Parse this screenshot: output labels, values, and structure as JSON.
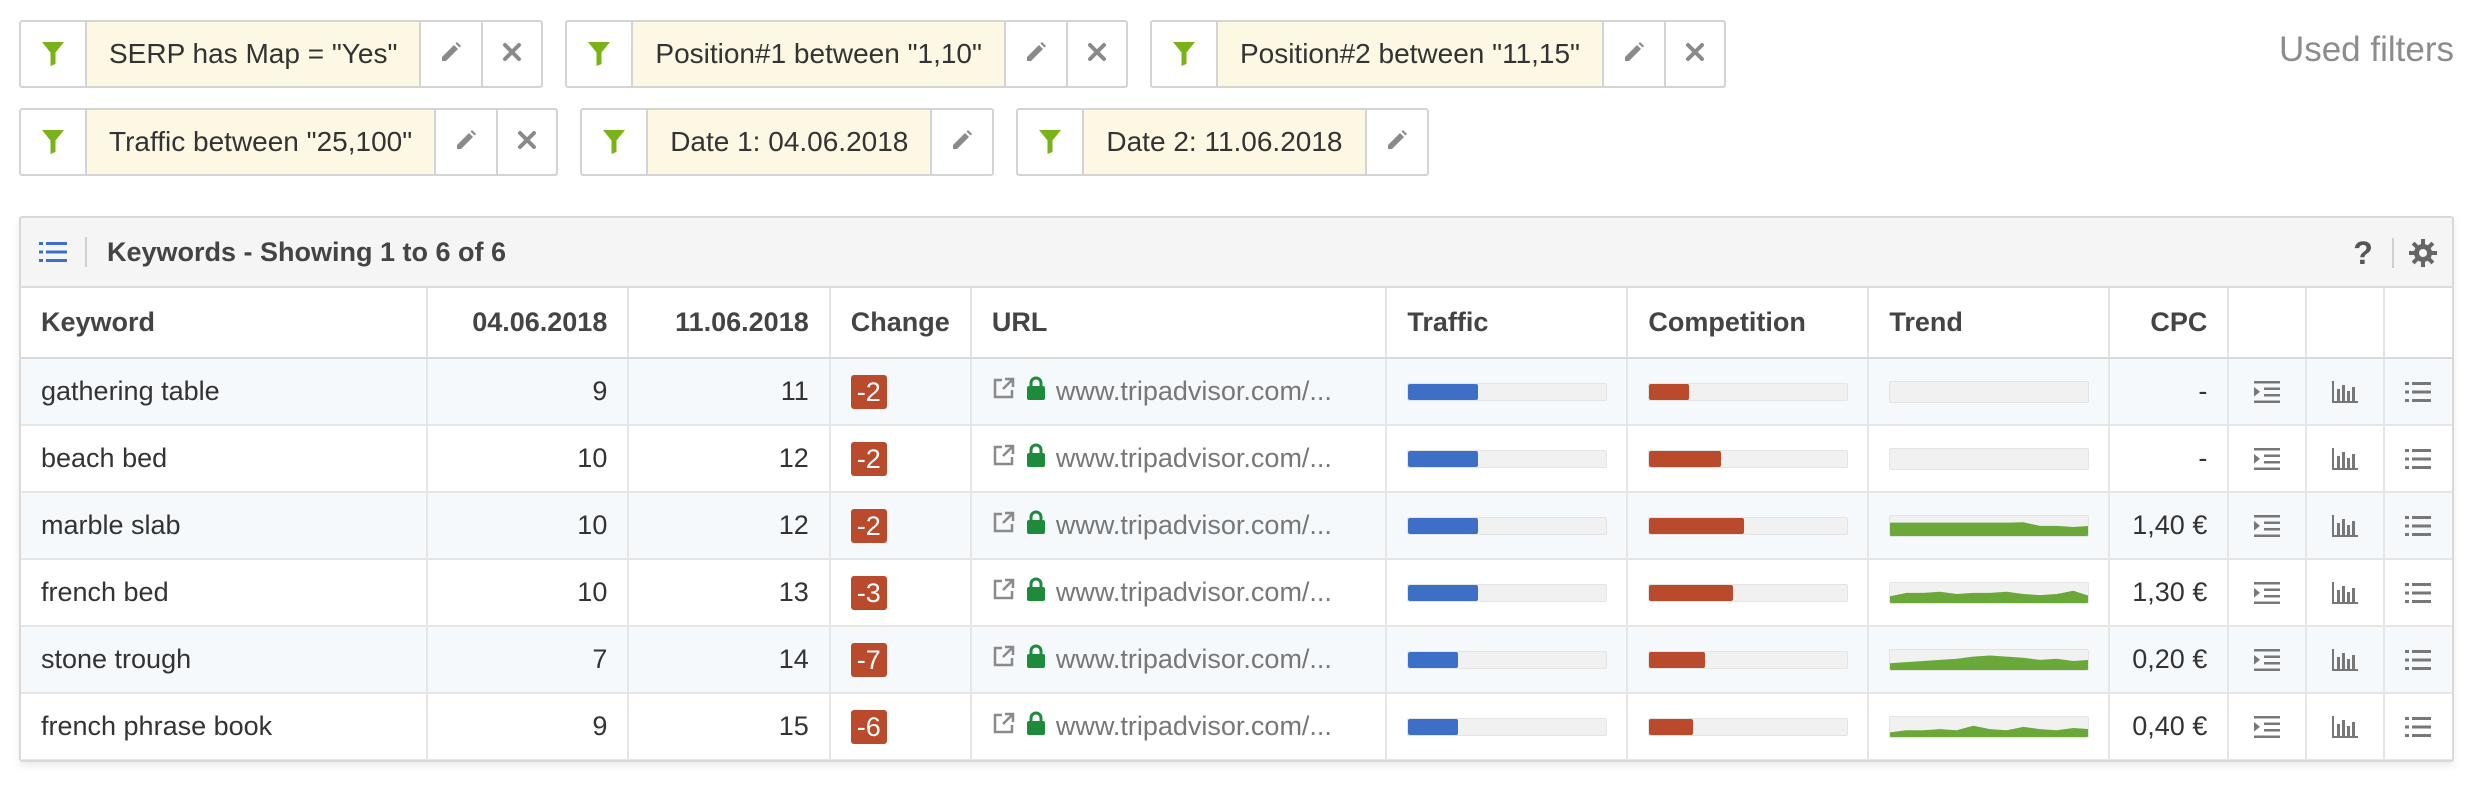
{
  "filters": [
    {
      "label": "SERP has Map = \"Yes\"",
      "removable": true
    },
    {
      "label": "Position#1 between \"1,10\"",
      "removable": true
    },
    {
      "label": "Position#2 between \"11,15\"",
      "removable": true
    },
    {
      "label": "Traffic between \"25,100\"",
      "removable": true
    },
    {
      "label": "Date 1: 04.06.2018",
      "removable": false
    },
    {
      "label": "Date 2: 11.06.2018",
      "removable": false
    }
  ],
  "used_filters_label": "Used filters",
  "panel": {
    "title": "Keywords - Showing 1 to 6 of 6",
    "help": "?"
  },
  "columns": {
    "keyword": "Keyword",
    "date1": "04.06.2018",
    "date2": "11.06.2018",
    "change": "Change",
    "url": "URL",
    "traffic": "Traffic",
    "competition": "Competition",
    "trend": "Trend",
    "cpc": "CPC"
  },
  "rows": [
    {
      "keyword": "gathering table",
      "pos1": "9",
      "pos2": "11",
      "change": "-2",
      "url": "www.tripadvisor.com/...",
      "traffic": 0.35,
      "competition": 0.2,
      "trend": [],
      "cpc": "-"
    },
    {
      "keyword": "beach bed",
      "pos1": "10",
      "pos2": "12",
      "change": "-2",
      "url": "www.tripadvisor.com/...",
      "traffic": 0.35,
      "competition": 0.36,
      "trend": [],
      "cpc": "-"
    },
    {
      "keyword": "marble slab",
      "pos1": "10",
      "pos2": "12",
      "change": "-2",
      "url": "www.tripadvisor.com/...",
      "traffic": 0.35,
      "competition": 0.48,
      "trend": [
        0.7,
        0.7,
        0.7,
        0.7,
        0.7,
        0.7,
        0.7,
        0.7,
        0.72,
        0.55,
        0.55,
        0.5,
        0.55
      ],
      "cpc": "1,40 €"
    },
    {
      "keyword": "french bed",
      "pos1": "10",
      "pos2": "13",
      "change": "-3",
      "url": "www.tripadvisor.com/...",
      "traffic": 0.35,
      "competition": 0.42,
      "trend": [
        0.4,
        0.55,
        0.55,
        0.6,
        0.5,
        0.55,
        0.55,
        0.6,
        0.5,
        0.45,
        0.5,
        0.65,
        0.4
      ],
      "cpc": "1,30 €"
    },
    {
      "keyword": "stone trough",
      "pos1": "7",
      "pos2": "14",
      "change": "-7",
      "url": "www.tripadvisor.com/...",
      "traffic": 0.25,
      "competition": 0.28,
      "trend": [
        0.4,
        0.45,
        0.5,
        0.55,
        0.6,
        0.7,
        0.75,
        0.7,
        0.65,
        0.55,
        0.6,
        0.5,
        0.55
      ],
      "cpc": "0,20 €"
    },
    {
      "keyword": "french phrase book",
      "pos1": "9",
      "pos2": "15",
      "change": "-6",
      "url": "www.tripadvisor.com/...",
      "traffic": 0.25,
      "competition": 0.22,
      "trend": [
        0.3,
        0.4,
        0.4,
        0.45,
        0.4,
        0.6,
        0.45,
        0.4,
        0.55,
        0.45,
        0.4,
        0.5,
        0.45
      ],
      "cpc": "0,40 €"
    }
  ],
  "colors": {
    "funnel": "#7ab317",
    "traffic_bar": "#3d6fc7",
    "competition_bar": "#b94a2c",
    "trend_fill": "#6aa83a",
    "secure_lock": "#1e8a3c",
    "change_badge": "#b94a2c",
    "filter_bg": "#fcf8e3",
    "list_icon": "#3d6fc7"
  },
  "icons": {
    "filter": "funnel-icon",
    "edit": "pencil-icon",
    "remove": "close-icon",
    "list": "list-icon",
    "help": "help-icon",
    "settings": "gear-icon",
    "external": "external-link-icon",
    "secure": "lock-icon",
    "serp": "indent-icon",
    "history": "bar-chart-icon",
    "details": "details-list-icon"
  }
}
